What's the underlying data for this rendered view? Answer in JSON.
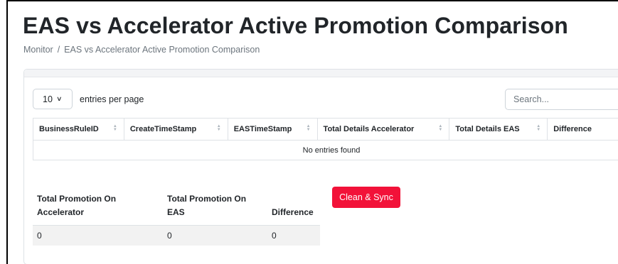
{
  "page": {
    "title": "EAS vs Accelerator Active Promotion Comparison",
    "breadcrumb": [
      "Monitor",
      "/",
      "EAS vs Accelerator Active Promotion Comparison"
    ]
  },
  "table_controls": {
    "page_size": "10",
    "entries_label": "entries per page",
    "search_placeholder": "Search..."
  },
  "grid": {
    "columns": [
      "BusinessRuleID",
      "CreateTimeStamp",
      "EASTimeStamp",
      "Total Details Accelerator",
      "Total Details EAS",
      "Difference"
    ],
    "empty_message": "No entries found"
  },
  "totals": {
    "headers": [
      "Total Promotion On Accelerator",
      "Total Promotion On EAS",
      "Difference"
    ],
    "values": [
      "0",
      "0",
      "0"
    ]
  },
  "actions": {
    "clean_sync_label": "Clean & Sync",
    "clean_sync_color": "#f21239"
  },
  "icons": {
    "select_chevron": "chevron-down-icon",
    "sort": "sort-icon"
  }
}
